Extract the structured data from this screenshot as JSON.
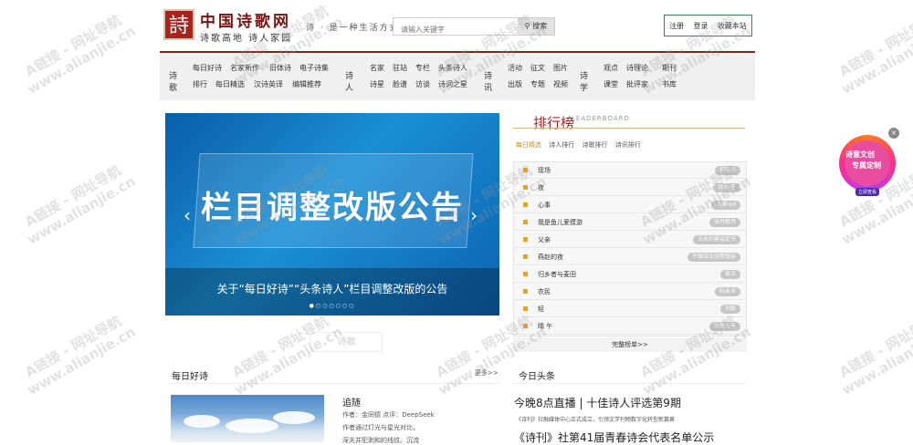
{
  "header": {
    "logo_glyph": "詩",
    "site_name": "中国诗歌网",
    "site_sub": "诗歌高地 诗人家园",
    "slogan": "诗 · 是一种生活方式",
    "search_placeholder": "请输入关键字",
    "search_button": "搜索",
    "user_links": [
      "注册",
      "登录",
      "收藏本站"
    ]
  },
  "nav": [
    {
      "head": "诗歌",
      "items": [
        [
          "每日好诗",
          "名家新作",
          "旧体诗",
          "电子诗集"
        ],
        [
          "排行",
          "每日精选",
          "汉诗英译",
          "编辑推荐"
        ]
      ]
    },
    {
      "head": "诗人",
      "items": [
        [
          "名家",
          "驻站",
          "专栏",
          "头条诗人"
        ],
        [
          "诗星",
          "脸谱",
          "访谈",
          "诗词之星"
        ]
      ]
    },
    {
      "head": "诗讯",
      "items": [
        [
          "活动",
          "征文",
          "图片"
        ],
        [
          "出版",
          "专题",
          "视频"
        ]
      ]
    },
    {
      "head": "诗学",
      "items": [
        [
          "观点",
          "诗理论",
          "期刊"
        ],
        [
          "课堂",
          "批评家",
          "书库"
        ]
      ]
    }
  ],
  "banner": {
    "title": "栏目调整改版公告",
    "caption": "关于“每日好诗”“头条诗人”栏目调整改版的公告",
    "dots": "●○○○○○○",
    "prev": "‹",
    "next": "›"
  },
  "faded_tab": "诗歌",
  "rank": {
    "title": "排行榜",
    "subtitle": "LEADERBOARD",
    "tabs": [
      "每日精选",
      "诗人排行",
      "诗歌排行",
      "诗讯排行"
    ],
    "rows": [
      {
        "name": "现场",
        "author": "倪晓人"
      },
      {
        "name": "夜",
        "author": "诗人·子"
      },
      {
        "name": "心事",
        "author": "大漠red"
      },
      {
        "name": "我是鱼儿爱摸游",
        "author": "张丹敏丹"
      },
      {
        "name": "父亲",
        "author": "王永约尊设定书"
      },
      {
        "name": "燕赵的夜",
        "author": "不做结论见情慢亲"
      },
      {
        "name": "归乡者与麦田",
        "author": "爱玉"
      },
      {
        "name": "农民",
        "author": "陆永卓"
      },
      {
        "name": "轻",
        "author": "刘聪"
      },
      {
        "name": "晴 午",
        "author": "寂秋无声"
      }
    ],
    "more": "完整榜单>>"
  },
  "daily": {
    "title": "每日好诗",
    "more": "更多>>",
    "poem_title": "追随",
    "poem_meta": "作者：金同德  点评：DeepSeek",
    "poem_lines": [
      "作者通过灯光与星光对比，",
      "深夫并犯剥和的线纹。沉流"
    ]
  },
  "headlines": {
    "title": "今日头条",
    "big1": "今晚8点直播 | 十佳诗人评选第9期",
    "small1": "《诗刊》社融媒体中心正式成立，引领文学刊物数字化转型新篇章",
    "big2": "《诗刊》社第41届青春诗会代表名单公示"
  },
  "float_ad": {
    "line1": "诗意文创",
    "line2": "专属定制",
    "line3": "立即查看",
    "close": "×"
  },
  "watermark": {
    "line1": "A链接 - 网址导航",
    "line2": "www.alianjie.cn"
  }
}
